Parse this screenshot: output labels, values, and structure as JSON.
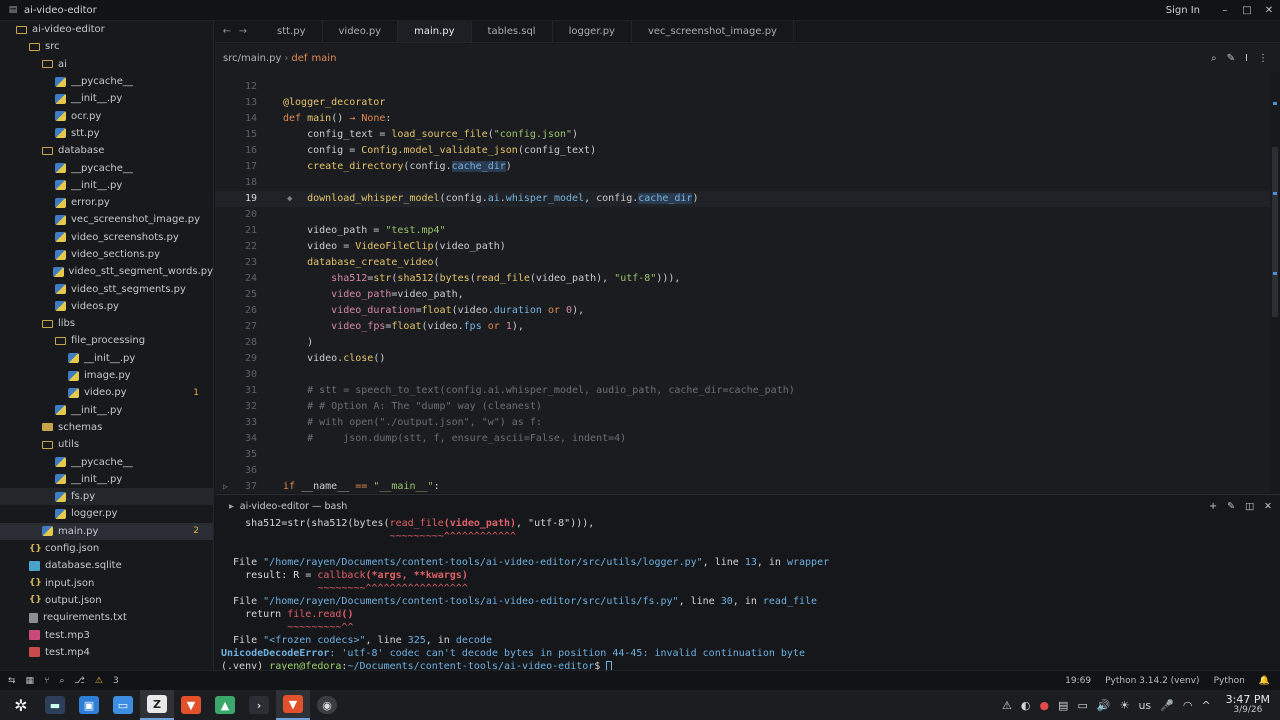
{
  "window": {
    "title": "ai-video-editor",
    "signin": "Sign In",
    "min": "–",
    "max": "□",
    "close": "✕"
  },
  "sidebar": {
    "items": [
      {
        "label": "ai-video-editor",
        "depth": 0,
        "icon": "folder-open",
        "chev": "▾"
      },
      {
        "label": "src",
        "depth": 1,
        "icon": "folder-open",
        "chev": "▾"
      },
      {
        "label": "ai",
        "depth": 2,
        "icon": "folder-open",
        "chev": "▾"
      },
      {
        "label": "__pycache__",
        "depth": 3,
        "icon": "py"
      },
      {
        "label": "__init__.py",
        "depth": 3,
        "icon": "py"
      },
      {
        "label": "ocr.py",
        "depth": 3,
        "icon": "py"
      },
      {
        "label": "stt.py",
        "depth": 3,
        "icon": "py"
      },
      {
        "label": "database",
        "depth": 2,
        "icon": "folder-open",
        "chev": "▾"
      },
      {
        "label": "__pycache__",
        "depth": 3,
        "icon": "py"
      },
      {
        "label": "__init__.py",
        "depth": 3,
        "icon": "py"
      },
      {
        "label": "error.py",
        "depth": 3,
        "icon": "py"
      },
      {
        "label": "vec_screenshot_image.py",
        "depth": 3,
        "icon": "py"
      },
      {
        "label": "video_screenshots.py",
        "depth": 3,
        "icon": "py"
      },
      {
        "label": "video_sections.py",
        "depth": 3,
        "icon": "py"
      },
      {
        "label": "video_stt_segment_words.py",
        "depth": 3,
        "icon": "py"
      },
      {
        "label": "video_stt_segments.py",
        "depth": 3,
        "icon": "py"
      },
      {
        "label": "videos.py",
        "depth": 3,
        "icon": "py"
      },
      {
        "label": "libs",
        "depth": 2,
        "icon": "folder-open",
        "chev": "▾"
      },
      {
        "label": "file_processing",
        "depth": 3,
        "icon": "folder-open",
        "chev": "▾"
      },
      {
        "label": "__init__.py",
        "depth": 4,
        "icon": "py"
      },
      {
        "label": "image.py",
        "depth": 4,
        "icon": "py"
      },
      {
        "label": "video.py",
        "depth": 4,
        "icon": "py",
        "badge": "1"
      },
      {
        "label": "__init__.py",
        "depth": 3,
        "icon": "py"
      },
      {
        "label": "schemas",
        "depth": 2,
        "icon": "folder",
        "chev": "▸"
      },
      {
        "label": "utils",
        "depth": 2,
        "icon": "folder-open",
        "chev": "▾"
      },
      {
        "label": "__pycache__",
        "depth": 3,
        "icon": "py"
      },
      {
        "label": "__init__.py",
        "depth": 3,
        "icon": "py"
      },
      {
        "label": "fs.py",
        "depth": 3,
        "icon": "py",
        "hl": true
      },
      {
        "label": "logger.py",
        "depth": 3,
        "icon": "py"
      },
      {
        "label": "main.py",
        "depth": 2,
        "icon": "py",
        "badge": "2",
        "selected": true
      },
      {
        "label": "config.json",
        "depth": 1,
        "icon": "json"
      },
      {
        "label": "database.sqlite",
        "depth": 1,
        "icon": "sqlite"
      },
      {
        "label": "input.json",
        "depth": 1,
        "icon": "json"
      },
      {
        "label": "output.json",
        "depth": 1,
        "icon": "json"
      },
      {
        "label": "requirements.txt",
        "depth": 1,
        "icon": "txt"
      },
      {
        "label": "test.mp3",
        "depth": 1,
        "icon": "mp3"
      },
      {
        "label": "test.mp4",
        "depth": 1,
        "icon": "mp4"
      }
    ]
  },
  "tabs": [
    {
      "label": "stt.py",
      "active": false
    },
    {
      "label": "video.py",
      "active": false
    },
    {
      "label": "main.py",
      "active": true
    },
    {
      "label": "tables.sql",
      "active": false
    },
    {
      "label": "logger.py",
      "active": false
    },
    {
      "label": "vec_screenshot_image.py",
      "active": false
    }
  ],
  "breadcrumb": {
    "path": "src/main.py",
    "sep": "›",
    "keyword": "def",
    "fn": "main"
  },
  "editor": {
    "current_line": "19",
    "lines": [
      {
        "n": "12",
        "html": ""
      },
      {
        "n": "13",
        "html": "<span class='f'>@logger_decorator</span>"
      },
      {
        "n": "14",
        "html": "<span class='k'>def</span> <span class='f'>main</span>() <span class='op'>→</span> <span class='k'>None</span>:"
      },
      {
        "n": "15",
        "html": "    config_text = <span class='f'>load_source_file</span>(<span class='s'>\"config.json\"</span>)"
      },
      {
        "n": "16",
        "html": "    config = <span class='cl'>Config</span>.<span class='f'>model_validate_json</span>(config_text)"
      },
      {
        "n": "17",
        "html": "    <span class='f'>create_directory</span>(config.<span class='a hlw'>cache_dir</span>)"
      },
      {
        "n": "18",
        "html": ""
      },
      {
        "n": "19",
        "html": "    <span class='f'>download_whisper_model</span>(config.<span class='a'>ai</span>.<span class='a'>whisper_model</span>, config.<span class='a hlw'>cache_dir</span>)"
      },
      {
        "n": "20",
        "html": ""
      },
      {
        "n": "21",
        "html": "    video_path = <span class='s'>\"test.mp4\"</span>"
      },
      {
        "n": "22",
        "html": "    video = <span class='cl'>VideoFileClip</span>(video_path)"
      },
      {
        "n": "23",
        "html": "    <span class='f'>database_create_video</span>("
      },
      {
        "n": "24",
        "html": "        <span class='n'>sha512</span>=<span class='f'>str</span>(<span class='f'>sha512</span>(<span class='f'>bytes</span>(<span class='f'>read_file</span>(video_path), <span class='s'>\"utf-8\"</span>))),"
      },
      {
        "n": "25",
        "html": "        <span class='n'>video_path</span>=video_path,"
      },
      {
        "n": "26",
        "html": "        <span class='n'>video_duration</span>=<span class='f'>float</span>(video.<span class='a'>duration</span> <span class='k'>or</span> <span class='n'>0</span>),"
      },
      {
        "n": "27",
        "html": "        <span class='n'>video_fps</span>=<span class='f'>float</span>(video.<span class='a'>fps</span> <span class='k'>or</span> <span class='n'>1</span>),"
      },
      {
        "n": "28",
        "html": "    )"
      },
      {
        "n": "29",
        "html": "    video.<span class='f'>close</span>()"
      },
      {
        "n": "30",
        "html": ""
      },
      {
        "n": "31",
        "html": "    <span class='c'># stt = speech_to_text(config.ai.whisper_model, audio_path, cache_dir=cache_path)</span>"
      },
      {
        "n": "32",
        "html": "    <span class='c'># # Option A: The \"dump\" way (cleanest)</span>"
      },
      {
        "n": "33",
        "html": "    <span class='c'># with open(\"./output.json\", \"w\") as f:</span>"
      },
      {
        "n": "34",
        "html": "    <span class='c'>#     json.dump(stt, f, ensure_ascii=False, indent=4)</span>"
      },
      {
        "n": "35",
        "html": ""
      },
      {
        "n": "36",
        "html": ""
      },
      {
        "n": "37",
        "html": "<span class='k'>if</span> __name__ <span class='op'>==</span> <span class='s'>\"__main__\"</span>:"
      }
    ]
  },
  "terminal": {
    "title": "ai-video-editor — bash",
    "lines": [
      "    sha512=str(sha512(bytes(<span class='t-red'>read_file</span><span class='t-redb'>(video_path)</span>, \"utf-8\"))),",
      "                            <span class='t-red'>~~~~~~~~~^^^^^^^^^^^^</span>",
      "",
      "  File <span class='t-path'>\"/home/rayen/Documents/content-tools/ai-video-editor/src/utils/logger.py\"</span>, line <span class='t-path'>13</span>, in <span class='t-path'>wrapper</span>",
      "    result: R = <span class='t-red'>callback</span><span class='t-redb'>(*args, **kwargs)</span>",
      "                <span class='t-red'>~~~~~~~~^^^^^^^^^^^^^^^^^</span>",
      "  File <span class='t-path'>\"/home/rayen/Documents/content-tools/ai-video-editor/src/utils/fs.py\"</span>, line <span class='t-path'>30</span>, in <span class='t-path'>read_file</span>",
      "    return <span class='t-red'>file.read</span><span class='t-redb'>()</span>",
      "           <span class='t-red'>~~~~~~~~~^^</span>",
      "  File <span class='t-path'>\"&lt;frozen codecs&gt;\"</span>, line <span class='t-path'>325</span>, in <span class='t-path'>decode</span>",
      "<span class='t-err'><b>UnicodeDecodeError</b>: 'utf-8' codec can't decode bytes in position 44-45: invalid continuation byte</span>",
      "(.venv) <span class='t-green'>rayen@fedora</span>:<span class='t-path'>~/Documents/content-tools/ai-video-editor</span>$ <span class='t-cursor'></span>"
    ]
  },
  "statusbar": {
    "warnings": "3",
    "cursor": "19:69",
    "python": "Python 3.14.2 (venv)",
    "lang": "Python"
  },
  "taskbar": {
    "time": "3:47 PM",
    "date": "3/9/26",
    "keyboard": "us"
  }
}
